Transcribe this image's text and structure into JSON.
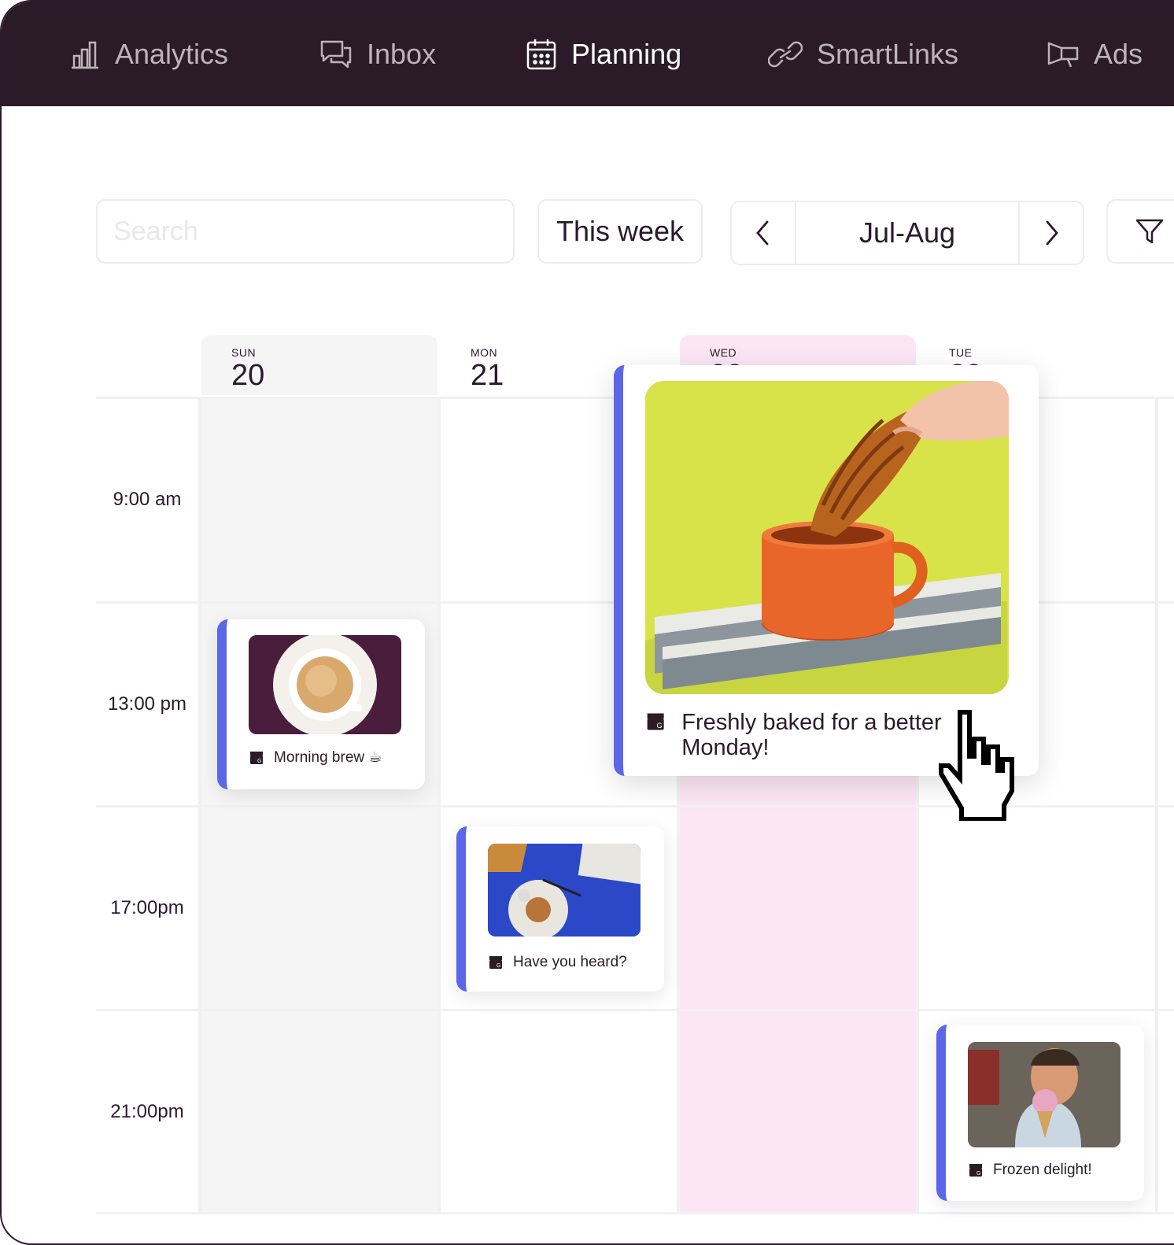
{
  "nav": {
    "items": [
      {
        "label": "Analytics",
        "icon": "bar-chart-icon",
        "active": false
      },
      {
        "label": "Inbox",
        "icon": "chat-bubbles-icon",
        "active": false
      },
      {
        "label": "Planning",
        "icon": "calendar-icon",
        "active": true
      },
      {
        "label": "SmartLinks",
        "icon": "link-icon",
        "active": false
      },
      {
        "label": "Ads",
        "icon": "megaphone-icon",
        "active": false
      }
    ]
  },
  "toolbar": {
    "search_placeholder": "Search",
    "period_label": "This week",
    "range_label": "Jul-Aug",
    "prev_icon": "chevron-left-icon",
    "next_icon": "chevron-right-icon",
    "filter_icon": "filter-icon"
  },
  "days": [
    {
      "dow": "SUN",
      "num": "20"
    },
    {
      "dow": "MON",
      "num": "21"
    },
    {
      "dow": "WED",
      "num": "22"
    },
    {
      "dow": "TUE",
      "num": "23"
    }
  ],
  "times": [
    "9:00 am",
    "13:00 pm",
    "17:00pm",
    "21:00pm"
  ],
  "posts": {
    "morning": {
      "caption": "Morning brew ☕",
      "icon": "google-business-icon"
    },
    "heard": {
      "caption": "Have you heard?",
      "icon": "google-business-icon"
    },
    "frozen": {
      "caption": "Frozen delight!",
      "icon": "google-business-icon"
    },
    "featured": {
      "caption": "Freshly baked for a better Monday!",
      "icon": "google-business-icon"
    }
  },
  "colors": {
    "nav_bg": "#2b1b29",
    "accent": "#5b67e8",
    "highlight_day": "#fce6f6",
    "cell_gray": "#f5f5f5"
  }
}
